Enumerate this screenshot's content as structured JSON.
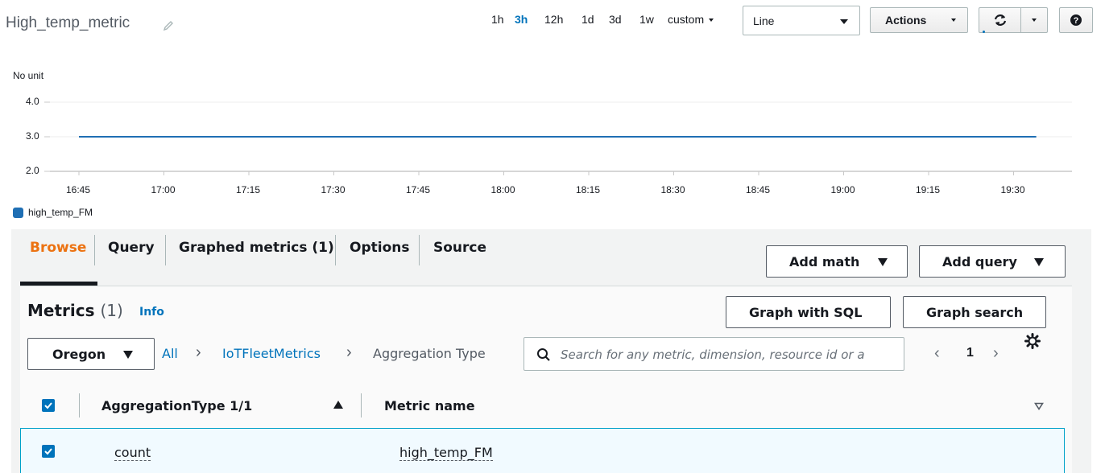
{
  "header": {
    "title": "High_temp_metric",
    "time_ranges": [
      "1h",
      "3h",
      "12h",
      "1d",
      "3d",
      "1w"
    ],
    "active_range": "3h",
    "custom_label": "custom",
    "chart_type_value": "Line",
    "actions_label": "Actions"
  },
  "chart_data": {
    "type": "line",
    "ylabel": "No unit",
    "y_ticks": [
      "4.0",
      "3.0",
      "2.0"
    ],
    "ylim": [
      2.0,
      4.0
    ],
    "x_ticks": [
      "16:45",
      "17:00",
      "17:15",
      "17:30",
      "17:45",
      "18:00",
      "18:15",
      "18:30",
      "18:45",
      "19:00",
      "19:15",
      "19:30"
    ],
    "series": [
      {
        "name": "high_temp_FM",
        "color": "#1f6fb4",
        "x": [
          "16:45",
          "19:34"
        ],
        "values": [
          3.0,
          3.0
        ]
      }
    ],
    "grid": true,
    "legend": "bottom-left"
  },
  "tabs": [
    {
      "label": "Browse",
      "active": true
    },
    {
      "label": "Query"
    },
    {
      "label": "Graphed metrics (1)"
    },
    {
      "label": "Options"
    },
    {
      "label": "Source"
    }
  ],
  "buttons": {
    "add_math": "Add math",
    "add_query": "Add query",
    "graph_sql": "Graph with SQL",
    "graph_search": "Graph search"
  },
  "metrics": {
    "heading": "Metrics",
    "count": "(1)",
    "info": "Info",
    "region": "Oregon",
    "breadcrumb": [
      "All",
      "IoTFleetMetrics",
      "Aggregation Type"
    ],
    "search_placeholder": "Search for any metric, dimension, resource id or a",
    "page": "1"
  },
  "table": {
    "columns": [
      "AggregationType 1/1",
      "Metric name"
    ],
    "rows": [
      {
        "aggregation_type": "count",
        "metric_name": "high_temp_FM",
        "checked": true
      }
    ]
  },
  "colors": {
    "accent": "#0073bb",
    "active_tab": "#ec7211",
    "series": "#1f6fb4"
  }
}
